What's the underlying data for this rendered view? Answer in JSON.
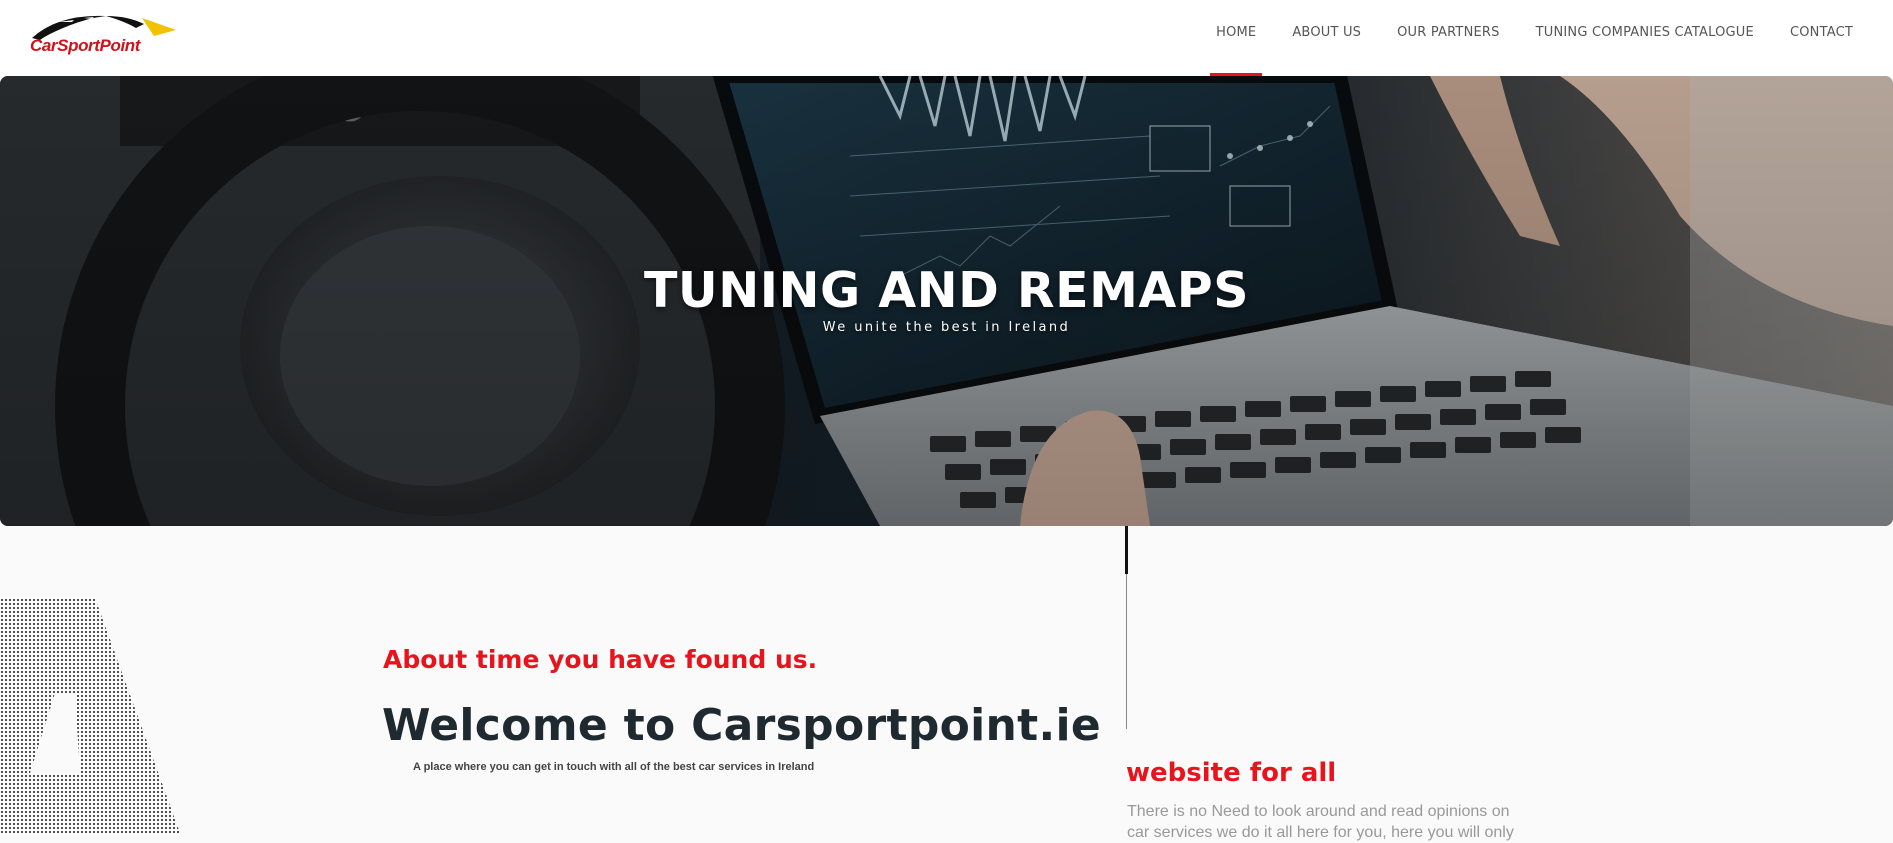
{
  "brand": {
    "name": "CarSportPoint",
    "accent_color": "#e8141d",
    "logo_yellow": "#f2c200"
  },
  "nav": {
    "items": [
      {
        "label": "HOME",
        "active": true
      },
      {
        "label": "ABOUT US",
        "active": false
      },
      {
        "label": "OUR PARTNERS",
        "active": false
      },
      {
        "label": "TUNING COMPANIES CATALOGUE",
        "active": false
      },
      {
        "label": "CONTACT",
        "active": false
      }
    ]
  },
  "hero": {
    "title": "TUNING AND REMAPS",
    "subtitle": "We unite the best in Ireland"
  },
  "welcome": {
    "tagline": "About time you have found us.",
    "title": "Welcome to Carsportpoint.ie",
    "subtitle": "A place where you can get in touch with all of the best car services in Ireland"
  },
  "side": {
    "heading": "website for all",
    "text": "There is no Need to look around and read opinions on car services we do it all here for you, here you will only"
  }
}
